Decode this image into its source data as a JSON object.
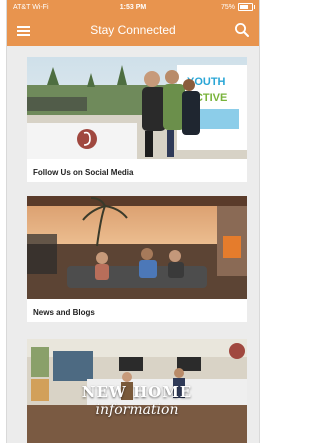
{
  "status_bar": {
    "carrier": "AT&T Wi-Fi",
    "time": "1:53 PM",
    "battery": "75%",
    "battery_level": 0.75
  },
  "header": {
    "title": "Stay Connected",
    "menu_icon": "hamburger-menu-icon",
    "search_icon": "search-icon"
  },
  "cards": [
    {
      "label": "Follow Us on Social Media"
    },
    {
      "label": "News and Blogs"
    },
    {
      "label": "",
      "overlay_line1": "NEW HOME",
      "overlay_line2": "information"
    }
  ],
  "colors": {
    "brand": "#e8944e",
    "background": "#ececec",
    "card": "#ffffff",
    "logo_badge": "#a0483f"
  }
}
